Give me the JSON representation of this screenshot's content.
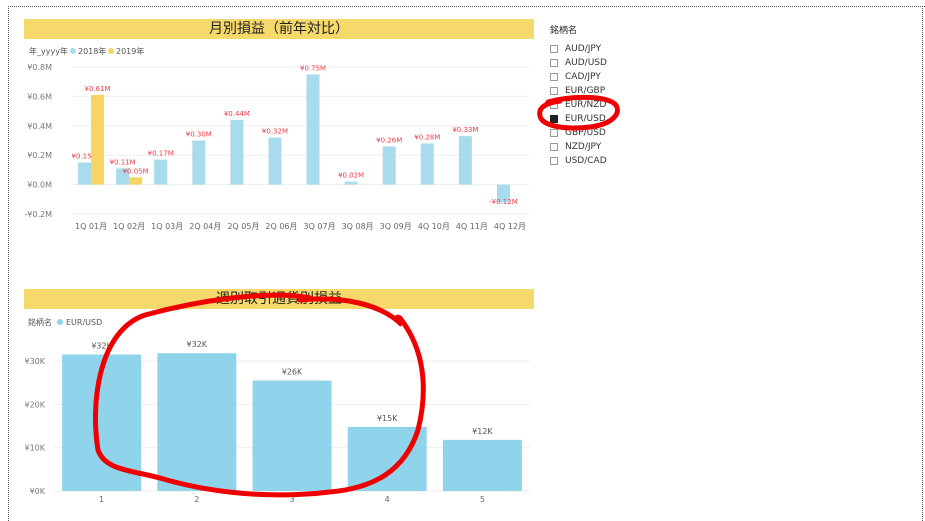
{
  "colors": {
    "title_bg": "#f5d96b",
    "series_2018": "#a8dcec",
    "series_2019": "#f6d565",
    "bar": "#8fd4ea",
    "label_red": "#e8424c",
    "annotation": "#ee0000"
  },
  "chart1": {
    "title": "月別損益（前年対比）",
    "legend_label": "年_yyyy年",
    "chart_data": {
      "type": "bar",
      "title": "月別損益（前年対比）",
      "categories": [
        "1Q 01月",
        "1Q 02月",
        "1Q 03月",
        "2Q 04月",
        "2Q 05月",
        "2Q 06月",
        "3Q 07月",
        "3Q 08月",
        "3Q 09月",
        "4Q 10月",
        "4Q 11月",
        "4Q 12月"
      ],
      "series": [
        {
          "name": "2018年",
          "values": [
            0.15,
            0.11,
            0.17,
            0.3,
            0.44,
            0.32,
            0.75,
            0.02,
            0.26,
            0.28,
            0.33,
            -0.12
          ],
          "labels": [
            "¥0.15M",
            "¥0.11M",
            "¥0.17M",
            "¥0.30M",
            "¥0.44M",
            "¥0.32M",
            "¥0.75M",
            "¥0.02M",
            "¥0.26M",
            "¥0.28M",
            "¥0.33M",
            "-¥0.12M"
          ]
        },
        {
          "name": "2019年",
          "values": [
            0.61,
            0.05,
            null,
            null,
            null,
            null,
            null,
            null,
            null,
            null,
            null,
            null
          ],
          "labels": [
            "¥0.61M",
            "¥0.05M",
            "",
            "",
            "",
            "",
            "",
            "",
            "",
            "",
            "",
            ""
          ]
        }
      ],
      "ylim": [
        -0.2,
        0.8
      ],
      "yticks": [
        -0.2,
        0.0,
        0.2,
        0.4,
        0.6,
        0.8
      ],
      "ytick_labels": [
        "-¥0.2M",
        "¥0.0M",
        "¥0.2M",
        "¥0.4M",
        "¥0.6M",
        "¥0.8M"
      ],
      "legend_position": "top-left",
      "grid": true
    }
  },
  "chart2": {
    "title": "週別取引通貨別損益",
    "legend_label": "銘柄名",
    "chart_data": {
      "type": "bar",
      "title": "週別取引通貨別損益",
      "categories": [
        "1",
        "2",
        "3",
        "4",
        "5"
      ],
      "series": [
        {
          "name": "EUR/USD",
          "values": [
            31.5,
            31.8,
            25.5,
            14.8,
            11.8
          ],
          "labels": [
            "¥32K",
            "¥32K",
            "¥26K",
            "¥15K",
            "¥12K"
          ]
        }
      ],
      "ylim": [
        0,
        33
      ],
      "yticks": [
        0,
        10,
        20,
        30
      ],
      "ytick_labels": [
        "¥0K",
        "¥10K",
        "¥20K",
        "¥30K"
      ],
      "legend_position": "top-left",
      "grid": true
    }
  },
  "slicer": {
    "title": "銘柄名",
    "items": [
      {
        "label": "AUD/JPY",
        "checked": false
      },
      {
        "label": "AUD/USD",
        "checked": false
      },
      {
        "label": "CAD/JPY",
        "checked": false
      },
      {
        "label": "EUR/GBP",
        "checked": false
      },
      {
        "label": "EUR/NZD",
        "checked": false
      },
      {
        "label": "EUR/USD",
        "checked": true
      },
      {
        "label": "GBP/USD",
        "checked": false
      },
      {
        "label": "NZD/JPY",
        "checked": false
      },
      {
        "label": "USD/CAD",
        "checked": false
      }
    ]
  }
}
